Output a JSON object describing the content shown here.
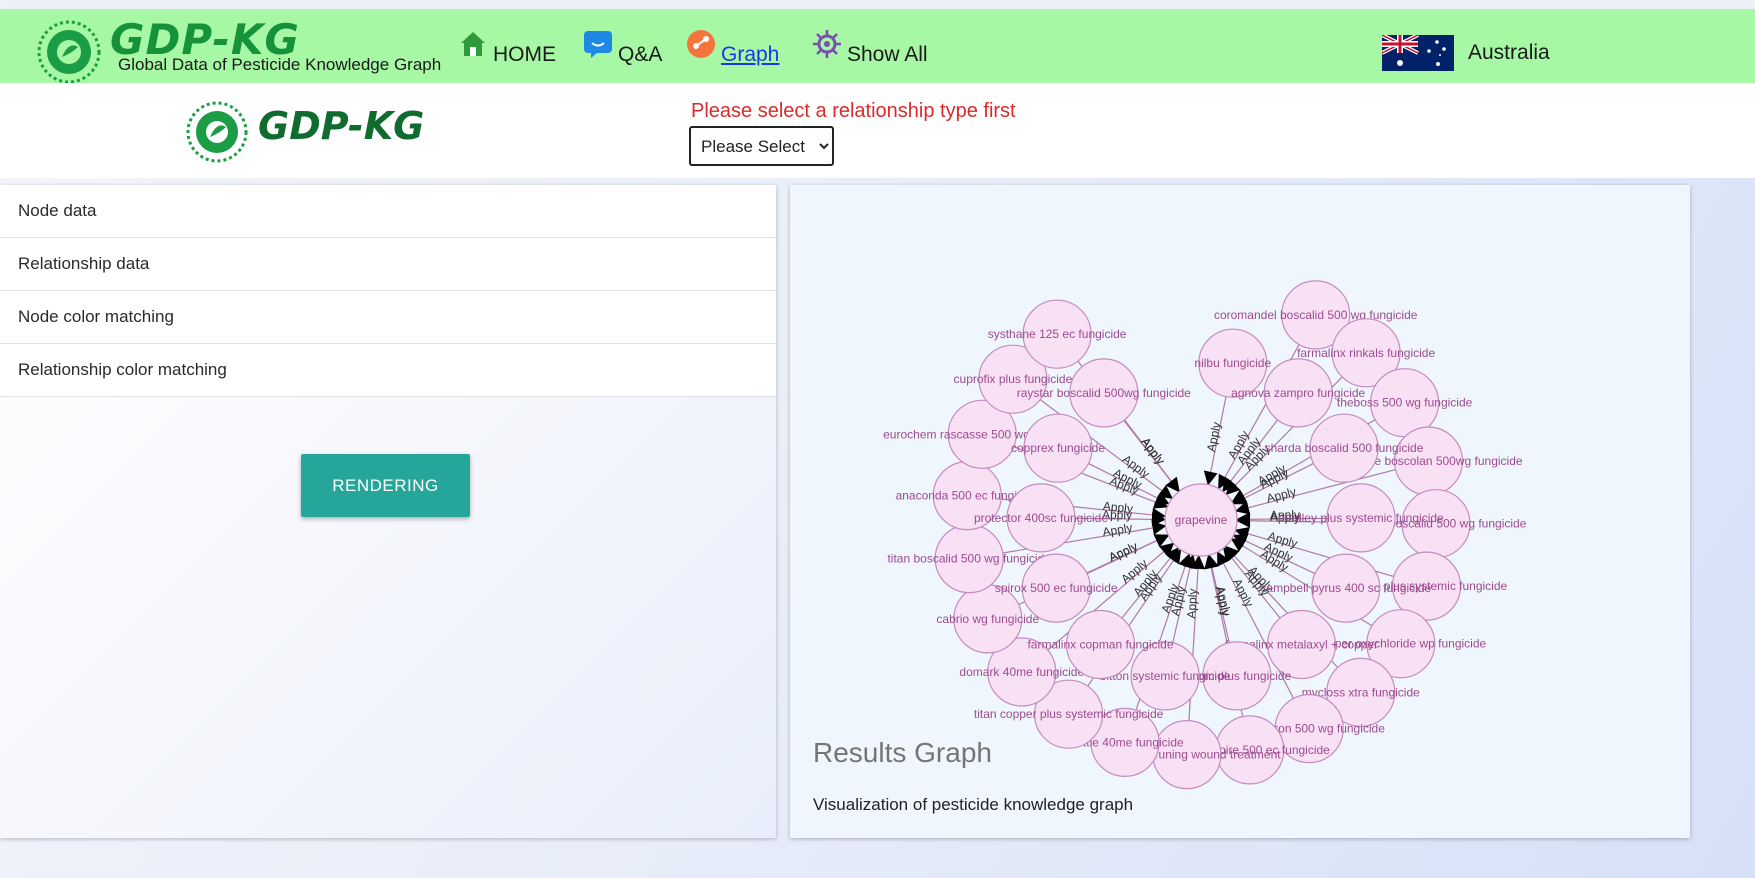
{
  "brand": {
    "title": "GDP-KG",
    "subtitle": "Global Data of Pesticide Knowledge Graph"
  },
  "nav": [
    {
      "label": "HOME",
      "icon": "home-icon",
      "active": false
    },
    {
      "label": "Q&A",
      "icon": "chat-icon",
      "active": false
    },
    {
      "label": "Graph",
      "icon": "graph-icon",
      "active": true
    },
    {
      "label": "Show All",
      "icon": "virus-icon",
      "active": false
    }
  ],
  "country": {
    "label": "Australia",
    "icon": "australia-flag-icon"
  },
  "subheader": {
    "logo_title": "GDP-KG",
    "relationship_message": "Please select a relationship type first",
    "relationship_select": {
      "selected": "Please Select"
    }
  },
  "accordion": [
    "Node data",
    "Relationship data",
    "Node color matching",
    "Relationship color matching"
  ],
  "render_button": "RENDERING",
  "card": {
    "title": "Results Graph",
    "subtitle": "Visualization of pesticide knowledge graph"
  },
  "graph": {
    "center": "grapevine",
    "relationship_label": "Apply",
    "node_fill": "#f9e1f5",
    "node_stroke": "#c58bc0",
    "edge_color": "#b07aa8",
    "nodes": [
      "coromandel boscalid 500 wg fungicide",
      "farmalinx rinkals fungicide",
      "theboss 500 wg fungicide",
      "cropsure boscolan 500wg fungicide",
      "surefire boscalid 500 wg fungicide",
      "zeemil plus systemic fungicide",
      "copper oxychloride wp fungicide",
      "mycloss xtra fungicide",
      "fme-patron 500 wg fungicide",
      "imtrade spire 500 ec fungicide",
      "sprayseal pruning wound treatment",
      "mettle 40me fungicide",
      "titan copper plus systemic fungicide",
      "domark 40me fungicide",
      "cabrio wg fungicide",
      "titan boscalid 500 wg fungicide",
      "anaconda 500 ec fungicide",
      "eurochem rascasse 500 wg fungicide",
      "cuprofix plus fungicide",
      "systhane 125 ec fungicide",
      "nilbu fungicide",
      "agnova zampro fungicide",
      "sharda boscalid 500 fungicide",
      "medley plus systemic fungicide",
      "campbell pyrus 400 sc fungicide",
      "farmalinx metalaxyl + copper",
      "axiom plus fungicide",
      "bitton systemic fungicide",
      "farmalinx copman fungicide",
      "spirox 500 ec fungicide",
      "protector 400sc fungicide",
      "copprex fungicide",
      "raystar boscalid 500wg fungicide"
    ]
  }
}
